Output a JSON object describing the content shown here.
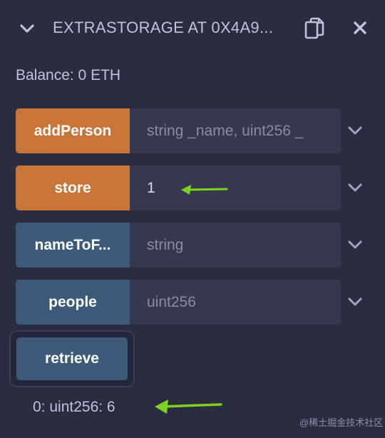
{
  "header": {
    "title": "EXTRASTORAGE AT 0X4A9...",
    "chevron_icon": "chevron-down-icon",
    "copy_icon": "copy-icon",
    "close_icon": "close-icon"
  },
  "balance": "Balance: 0 ETH",
  "functions": [
    {
      "label": "addPerson",
      "input_value": "",
      "input_placeholder": "string _name, uint256 _",
      "color": "#c97539"
    },
    {
      "label": "store",
      "input_value": "1",
      "input_placeholder": "",
      "color": "#c97539"
    },
    {
      "label": "nameToF...",
      "input_value": "",
      "input_placeholder": "string",
      "color": "#3d5b78"
    },
    {
      "label": "people",
      "input_value": "",
      "input_placeholder": "uint256",
      "color": "#3d5b78"
    }
  ],
  "retrieve": {
    "label": "retrieve",
    "result": "0: uint256: 6"
  },
  "annotations": {
    "arrow_color": "#7ed321"
  },
  "watermark": "@稀土掘金技术社区",
  "colors": {
    "background": "#2a2c3f",
    "transact_button": "#c97539",
    "call_button": "#3d5b78",
    "input_bg": "#35384e"
  }
}
